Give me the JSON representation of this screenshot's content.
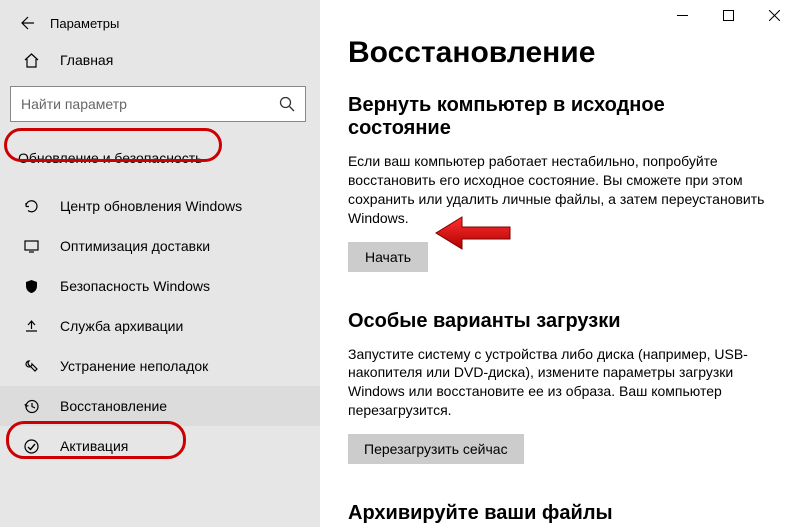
{
  "window": {
    "title": "Параметры"
  },
  "sidebar": {
    "home_label": "Главная",
    "search_placeholder": "Найти параметр",
    "section_heading": "Обновление и безопасность",
    "items": [
      {
        "label": "Центр обновления Windows"
      },
      {
        "label": "Оптимизация доставки"
      },
      {
        "label": "Безопасность Windows"
      },
      {
        "label": "Служба архивации"
      },
      {
        "label": "Устранение неполадок"
      },
      {
        "label": "Восстановление"
      },
      {
        "label": "Активация"
      }
    ]
  },
  "main": {
    "page_title": "Восстановление",
    "section1": {
      "heading": "Вернуть компьютер в исходное состояние",
      "desc": "Если ваш компьютер работает нестабильно, попробуйте восстановить его исходное состояние. Вы сможете при этом сохранить или удалить личные файлы, а затем переустановить Windows.",
      "button": "Начать"
    },
    "section2": {
      "heading": "Особые варианты загрузки",
      "desc": "Запустите систему с устройства либо диска (например, USB-накопителя или DVD-диска), измените параметры загрузки Windows или восстановите ее из образа. Ваш компьютер перезагрузится.",
      "button": "Перезагрузить сейчас"
    },
    "section3": {
      "heading": "Архивируйте ваши файлы"
    }
  }
}
